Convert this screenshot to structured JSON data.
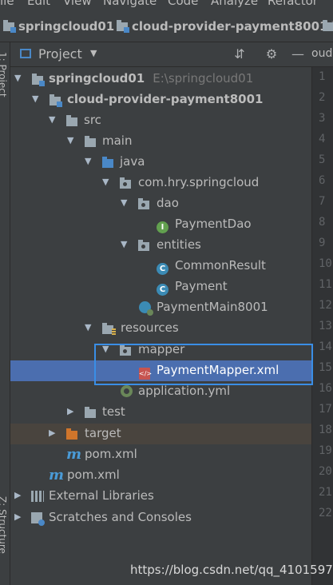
{
  "menubar": {
    "items": [
      "ile",
      "Edit",
      "View",
      "Navigate",
      "Code",
      "Analyze",
      "Refactor"
    ]
  },
  "breadcrumb": {
    "items": [
      "springcloud01",
      "cloud-provider-payment8001"
    ]
  },
  "left_strip": {
    "project_tab": "1: Project",
    "structure_tab": "Z: Structure"
  },
  "panel": {
    "title": "Project",
    "dropdown_icon": "chevron-down-icon"
  },
  "editor": {
    "tab_label": "oud",
    "line_numbers": [
      "1",
      "2",
      "3",
      "4",
      "5",
      "6",
      "7",
      "8",
      "9",
      "10",
      "11",
      "12",
      "13",
      "14",
      "15",
      "16",
      "17",
      "18",
      "19",
      "20",
      "21",
      "22"
    ]
  },
  "tree": [
    {
      "label": "springcloud01",
      "path": "E:\\springcloud01",
      "icon": "module-folder-icon",
      "expanded": true
    },
    {
      "label": "cloud-provider-payment8001",
      "icon": "module-folder-icon",
      "expanded": true
    },
    {
      "label": "src",
      "icon": "folder-icon",
      "expanded": true
    },
    {
      "label": "main",
      "icon": "folder-icon",
      "expanded": true
    },
    {
      "label": "java",
      "icon": "source-folder-icon",
      "expanded": true
    },
    {
      "label": "com.hry.springcloud",
      "icon": "package-icon",
      "expanded": true
    },
    {
      "label": "dao",
      "icon": "package-icon",
      "expanded": true
    },
    {
      "label": "PaymentDao",
      "icon": "interface-icon"
    },
    {
      "label": "entities",
      "icon": "package-icon",
      "expanded": true
    },
    {
      "label": "CommonResult",
      "icon": "class-icon"
    },
    {
      "label": "Payment",
      "icon": "class-icon"
    },
    {
      "label": "PaymentMain8001",
      "icon": "spring-boot-class-icon"
    },
    {
      "label": "resources",
      "icon": "resources-folder-icon",
      "expanded": true
    },
    {
      "label": "mapper",
      "icon": "package-icon",
      "expanded": true
    },
    {
      "label": "PaymentMapper.xml",
      "icon": "xml-file-icon",
      "selected": true
    },
    {
      "label": "application.yml",
      "icon": "yml-file-icon"
    },
    {
      "label": "test",
      "icon": "folder-icon",
      "expanded": false
    },
    {
      "label": "target",
      "icon": "excluded-folder-icon",
      "expanded": false
    },
    {
      "label": "pom.xml",
      "icon": "maven-icon"
    },
    {
      "label": "pom.xml",
      "icon": "maven-icon"
    },
    {
      "label": "External Libraries",
      "icon": "libraries-icon",
      "expanded": false
    },
    {
      "label": "Scratches and Consoles",
      "icon": "scratches-icon",
      "expanded": false
    }
  ],
  "colors": {
    "background": "#3c3f41",
    "selection": "#4b6eaf",
    "target_row": "#49443e",
    "highlight_border": "#3a8ee6"
  },
  "watermark": "https://blog.csdn.net/qq_41015977"
}
